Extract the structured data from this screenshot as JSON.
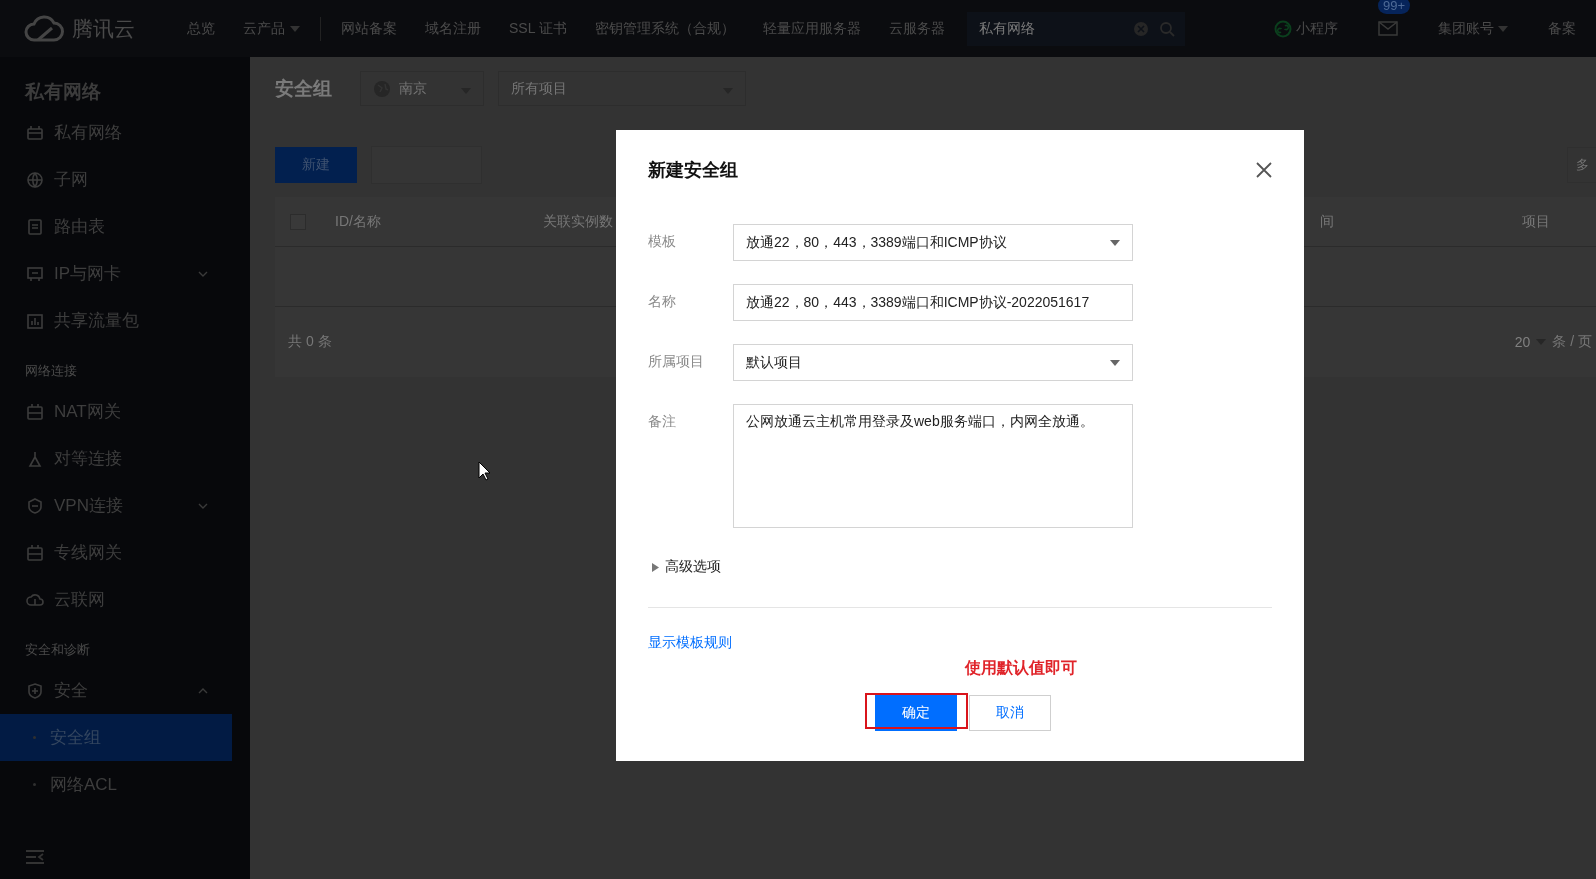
{
  "top_bar": {
    "logo": "腾讯云",
    "nav": [
      {
        "label": "总览",
        "kind": "link"
      },
      {
        "label": "云产品",
        "kind": "menu"
      },
      {
        "label": "网站备案",
        "kind": "link"
      },
      {
        "label": "域名注册",
        "kind": "link"
      },
      {
        "label": "SSL 证书",
        "kind": "link"
      },
      {
        "label": "密钥管理系统（合规）",
        "kind": "link"
      },
      {
        "label": "轻量应用服务器",
        "kind": "link"
      },
      {
        "label": "云服务器",
        "kind": "link"
      }
    ],
    "search": {
      "value": "私有网络"
    },
    "right": [
      {
        "kind": "miniprogram",
        "label": "小程序"
      },
      {
        "kind": "mail",
        "badge": "99+"
      },
      {
        "kind": "menu",
        "label": "集团账号"
      },
      {
        "kind": "link",
        "label": "备案"
      }
    ]
  },
  "sidebar": {
    "title": "私有网络",
    "items": [
      {
        "kind": "item",
        "label": "私有网络",
        "selected": false
      },
      {
        "kind": "item",
        "label": "子网",
        "selected": false
      },
      {
        "kind": "item",
        "label": "路由表",
        "selected": false
      },
      {
        "kind": "item",
        "label": "IP与网卡",
        "selected": false,
        "expanded": false
      },
      {
        "kind": "item",
        "label": "共享流量包",
        "selected": false
      },
      {
        "kind": "section",
        "label": "网络连接"
      },
      {
        "kind": "item",
        "label": "NAT网关",
        "selected": false
      },
      {
        "kind": "item",
        "label": "对等连接",
        "selected": false
      },
      {
        "kind": "item",
        "label": "VPN连接",
        "selected": false,
        "expanded": false
      },
      {
        "kind": "item",
        "label": "专线网关",
        "selected": false
      },
      {
        "kind": "item",
        "label": "云联网",
        "selected": false
      },
      {
        "kind": "section",
        "label": "安全和诊断"
      },
      {
        "kind": "item",
        "label": "安全",
        "selected": false,
        "expanded": true,
        "children": [
          {
            "label": "安全组",
            "selected": true
          },
          {
            "label": "网络ACL",
            "selected": false
          }
        ]
      }
    ]
  },
  "page": {
    "title": "安全组",
    "region": "南京",
    "project": "所有项目",
    "buttons": [
      {
        "kind": "primary",
        "label": "新建"
      },
      {
        "kind": "secondary"
      }
    ],
    "toolbar_right": "多",
    "table": {
      "select_all_checked": false,
      "columns": [
        "ID/名称",
        "关联实例数",
        "间",
        "项目"
      ],
      "total": "共 0 条",
      "page_size": "20",
      "page_size_unit": "条 / 页"
    }
  },
  "dialog": {
    "title": "新建安全组",
    "fields": [
      {
        "label": "模板",
        "kind": "select",
        "value": "放通22，80，443，3389端口和ICMP协议"
      },
      {
        "label": "名称",
        "kind": "text",
        "value": "放通22，80，443，3389端口和ICMP协议-2022051617"
      },
      {
        "label": "所属项目",
        "kind": "select",
        "value": "默认项目"
      },
      {
        "label": "备注",
        "kind": "textarea",
        "value": "公网放通云主机常用登录及web服务端口，内网全放通。"
      }
    ],
    "advanced": {
      "label": "高级选项",
      "expanded": false
    },
    "link": "显示模板规则",
    "annotation": "使用默认值即可",
    "buttons": [
      {
        "label": "确定",
        "kind": "primary"
      },
      {
        "label": "取消",
        "kind": "default"
      }
    ]
  }
}
